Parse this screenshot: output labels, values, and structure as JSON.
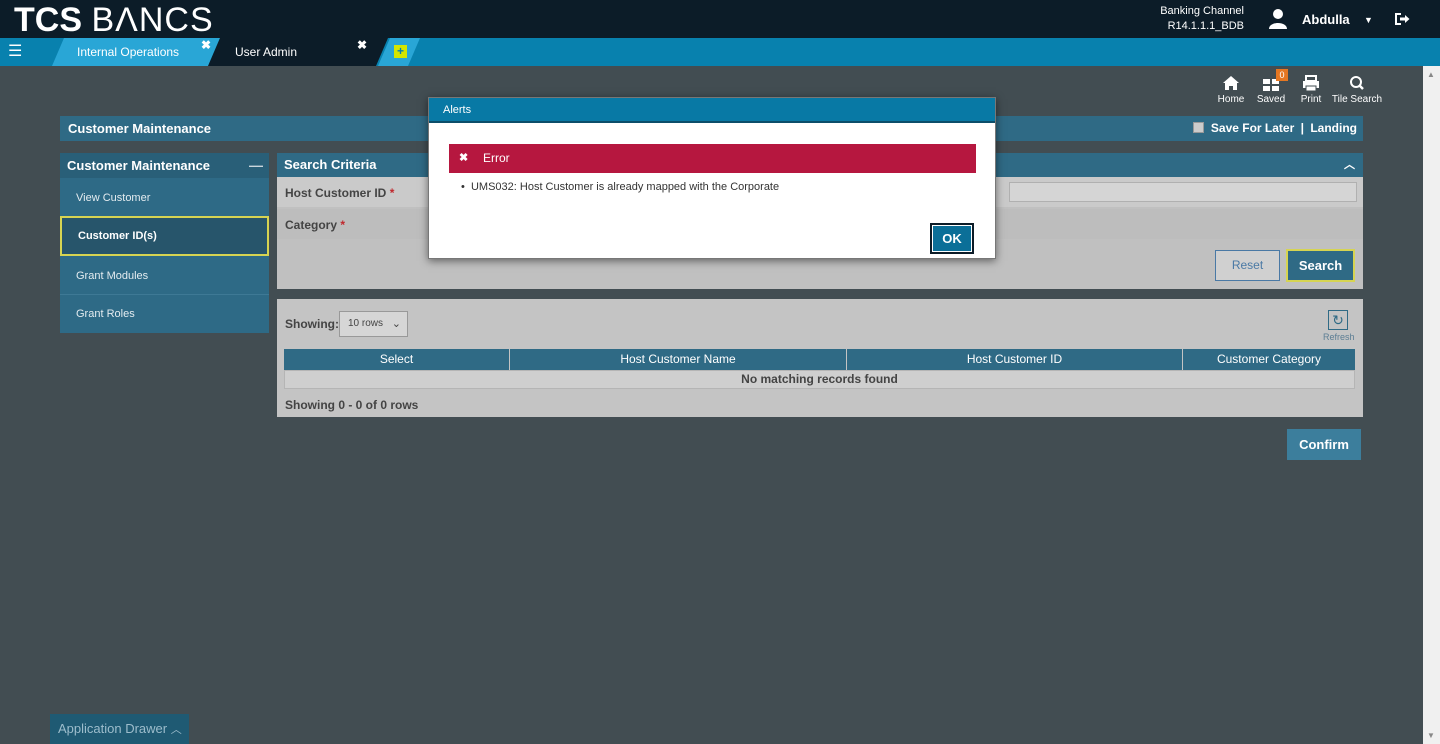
{
  "header": {
    "logo_tcs": "TCS",
    "logo_bancs": "BΛNCS",
    "channel_line1": "Banking Channel",
    "channel_line2": "R14.1.1.1_BDB",
    "user_name": "Abdulla"
  },
  "tabs": [
    {
      "label": "Internal Operations",
      "active": false
    },
    {
      "label": "User Admin",
      "active": true
    }
  ],
  "toolbar": {
    "home": "Home",
    "saved": "Saved",
    "saved_count": "0",
    "print": "Print",
    "tile_search": "Tile Search"
  },
  "page": {
    "title": "Customer Maintenance",
    "save_for_later": "Save For Later",
    "separator": "|",
    "landing": "Landing"
  },
  "sidebar": {
    "title": "Customer Maintenance",
    "items": [
      {
        "label": "View Customer"
      },
      {
        "label": "Customer ID(s)"
      },
      {
        "label": "Grant Modules"
      },
      {
        "label": "Grant Roles"
      }
    ]
  },
  "criteria": {
    "title": "Search Criteria",
    "host_customer_id_label": "Host Customer ID",
    "category_label": "Category",
    "required_mark": "*",
    "reset_label": "Reset",
    "search_label": "Search"
  },
  "results": {
    "showing_label": "Showing:",
    "rows_option": "10 rows",
    "refresh_label": "Refresh",
    "columns": [
      "Select",
      "Host Customer Name",
      "Host Customer ID",
      "Customer Category"
    ],
    "empty_message": "No matching records found",
    "footer": "Showing 0 - 0 of 0 rows"
  },
  "confirm_label": "Confirm",
  "drawer_label": "Application Drawer",
  "modal": {
    "title": "Alerts",
    "error_title": "Error",
    "message": "UMS032: Host Customer is already mapped with the Corporate",
    "ok_label": "OK"
  },
  "colors": {
    "header_bg": "#0c1c28",
    "tabbar_bg": "#0881ae",
    "panel_blue": "#2f6a85",
    "error_red": "#b6173f",
    "highlight_yellow": "#d6d452"
  }
}
